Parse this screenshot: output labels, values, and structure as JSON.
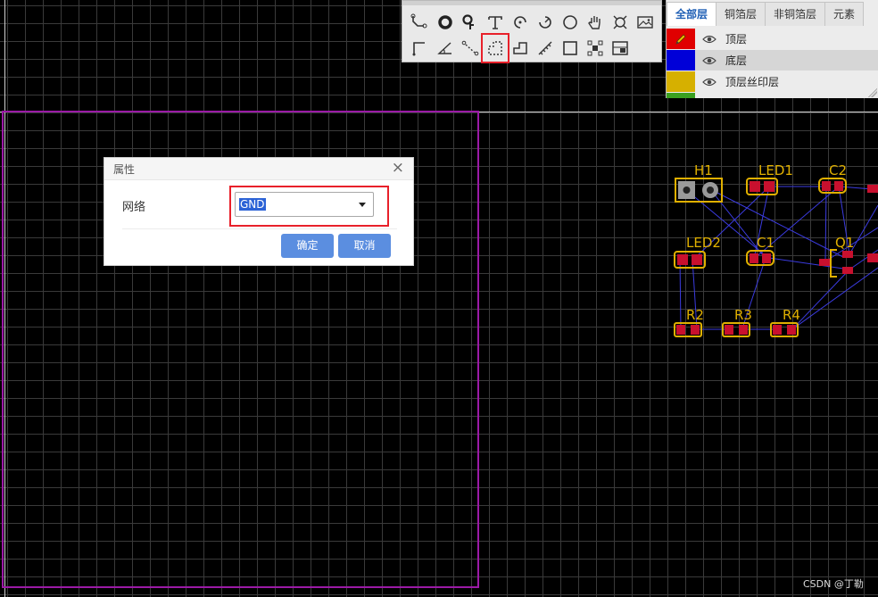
{
  "toolbar": {
    "row1": [
      "wire-icon",
      "via-icon",
      "pad-probe-icon",
      "text-icon",
      "arc-icon",
      "arc-center-icon",
      "circle-icon",
      "hand-icon",
      "dimension-icon",
      "image-icon"
    ],
    "row2": [
      "line-icon",
      "angle-icon",
      "dotted-line-icon",
      "copper-area-icon",
      "solid-area-icon",
      "measure-icon",
      "rectangle-icon",
      "select-group-icon",
      "canvas-origin-icon"
    ],
    "highlighted": "copper-area-icon"
  },
  "layers": {
    "tabs": [
      "全部层",
      "铜箔层",
      "非铜箔层",
      "元素"
    ],
    "active_tab": "全部层",
    "rows": [
      {
        "name": "顶层",
        "color": "#e00000",
        "bg": "#ececec"
      },
      {
        "name": "底层",
        "color": "#0000d8",
        "bg": "#d6d6d6"
      },
      {
        "name": "顶层丝印层",
        "color": "#d6b000",
        "bg": "#ececec"
      }
    ]
  },
  "dialog": {
    "title": "属性",
    "close_symbol": "×",
    "net_label": "网络",
    "net_value": "GND",
    "ok_label": "确定",
    "cancel_label": "取消"
  },
  "pcb": {
    "silkscreen_color": "#e0b000",
    "pad_color": "#c8102e",
    "ratsnest_color": "#3b3be0",
    "board_outline_color": "#9b1aa6",
    "components": [
      "H1",
      "LED1",
      "C2",
      "LED2",
      "C1",
      "Q1",
      "R2",
      "R3",
      "R4"
    ]
  },
  "watermark": "CSDN @丁勒"
}
